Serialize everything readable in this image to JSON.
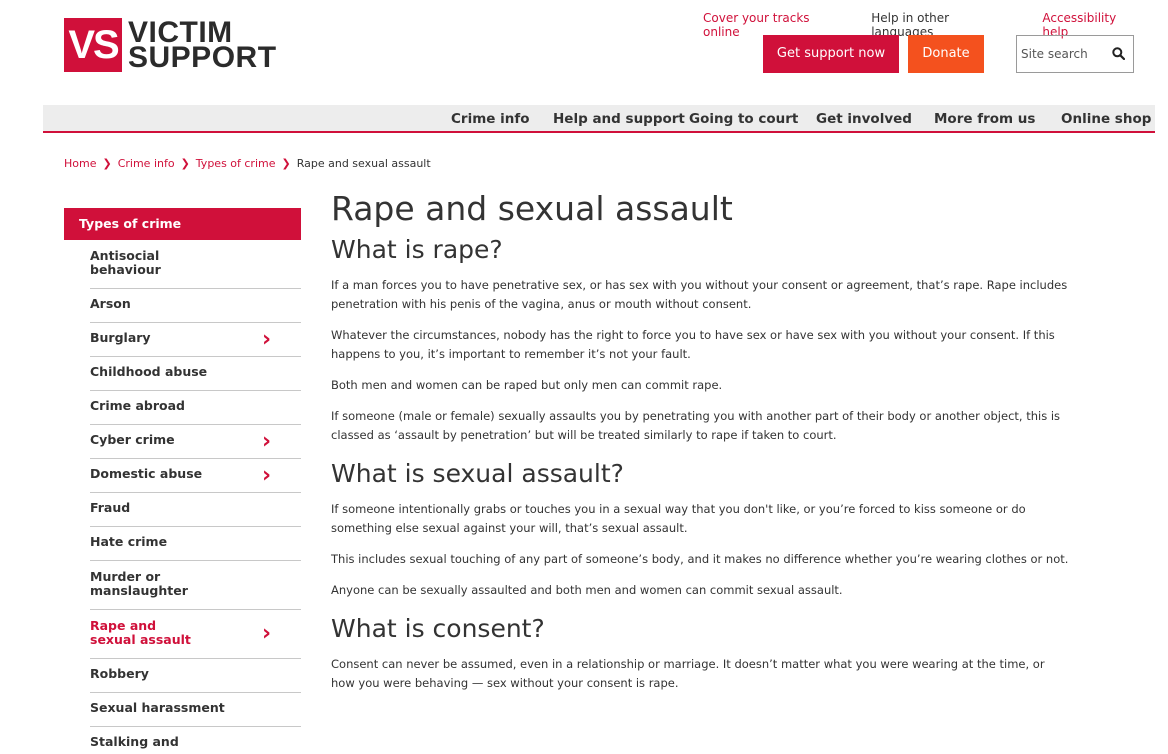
{
  "brand": {
    "logo_mark": "VS",
    "logo_line1": "VICTIM",
    "logo_line2": "SUPPORT"
  },
  "utility_links": [
    "Cover your tracks online",
    "Help in other languages",
    "Accessibility help"
  ],
  "header_buttons": {
    "support": "Get support now",
    "donate": "Donate"
  },
  "search": {
    "placeholder": "Site search"
  },
  "nav": [
    "Crime info",
    "Help and support",
    "Going to court",
    "Get involved",
    "More from us",
    "Online shop"
  ],
  "breadcrumb": [
    "Home",
    "Crime info",
    "Types of crime",
    "Rape and sexual assault"
  ],
  "sidebar": {
    "heading": "Types of crime",
    "items": [
      {
        "label": "Antisocial behaviour",
        "chevron": false,
        "active": false
      },
      {
        "label": "Arson",
        "chevron": false,
        "active": false
      },
      {
        "label": "Burglary",
        "chevron": true,
        "active": false
      },
      {
        "label": "Childhood abuse",
        "chevron": false,
        "active": false
      },
      {
        "label": "Crime abroad",
        "chevron": false,
        "active": false
      },
      {
        "label": "Cyber crime",
        "chevron": true,
        "active": false
      },
      {
        "label": "Domestic abuse",
        "chevron": true,
        "active": false
      },
      {
        "label": "Fraud",
        "chevron": false,
        "active": false
      },
      {
        "label": "Hate crime",
        "chevron": false,
        "active": false
      },
      {
        "label": "Murder or manslaughter",
        "chevron": false,
        "active": false
      },
      {
        "label": "Rape and sexual assault",
        "chevron": true,
        "active": true
      },
      {
        "label": "Robbery",
        "chevron": false,
        "active": false
      },
      {
        "label": "Sexual harassment",
        "chevron": false,
        "active": false
      },
      {
        "label": "Stalking and",
        "chevron": false,
        "active": false
      }
    ]
  },
  "article": {
    "title": "Rape and sexual assault",
    "sections": [
      {
        "heading": "What is rape?",
        "paragraphs": [
          "If a man forces you to have penetrative sex, or has sex with you without your consent or agreement, that’s rape. Rape includes penetration with his penis of the vagina, anus or mouth without consent.",
          "Whatever the circumstances, nobody has the right to force you to have sex or have sex with you without your consent. If this happens to you, it’s important to remember it’s not your fault.",
          "Both men and women can be raped but only men can commit rape.",
          "If someone (male or female) sexually assaults you by penetrating you with another part of their body or another object, this is classed as ‘assault by penetration’ but will be treated similarly to rape if taken to court."
        ]
      },
      {
        "heading": "What is sexual assault?",
        "paragraphs": [
          "If someone intentionally grabs or touches you in a sexual way that you don't like, or you’re forced to kiss someone or do something else sexual against your will, that’s sexual assault.",
          "This includes sexual touching of any part of someone’s body, and it makes no difference whether you’re wearing clothes or not.",
          "Anyone can be sexually assaulted and both men and women can commit sexual assault."
        ]
      },
      {
        "heading": "What is consent?",
        "paragraphs": [
          "Consent can never be assumed, even in a relationship or marriage. It doesn’t matter what you were wearing at the time, or how you were behaving — sex without your consent is rape."
        ]
      }
    ]
  },
  "colors": {
    "brand_red": "#d0103a",
    "donate_orange": "#f4511e",
    "nav_bg": "#ededed"
  }
}
